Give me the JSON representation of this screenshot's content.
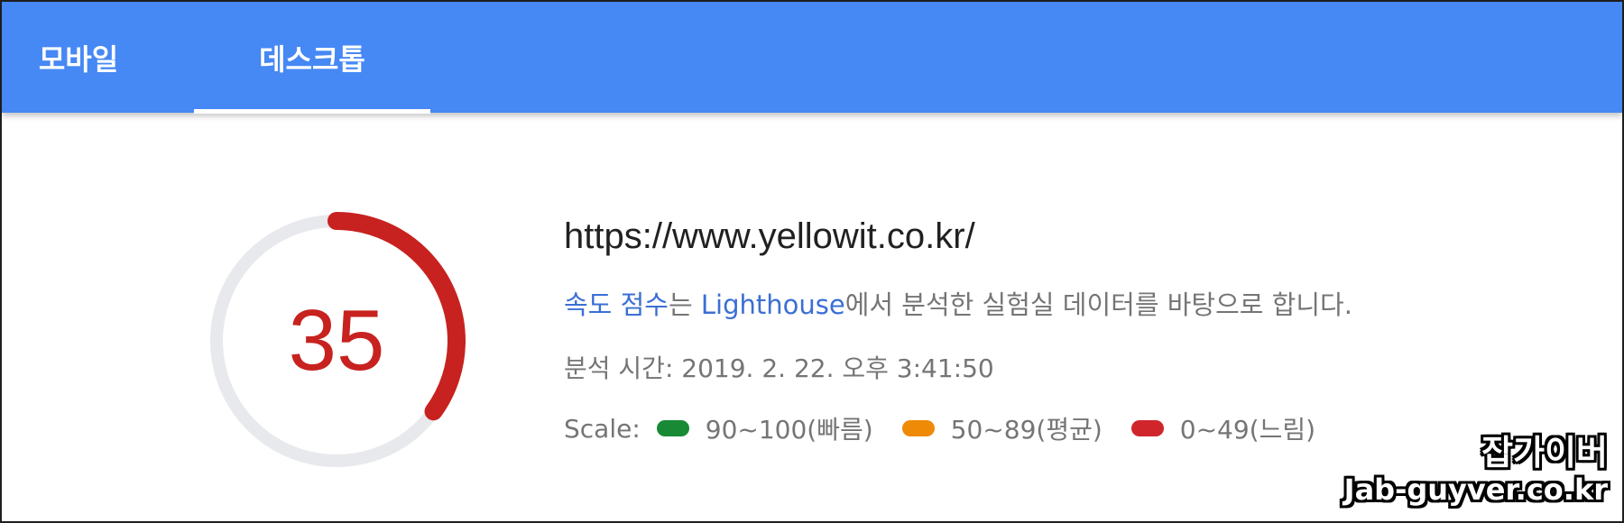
{
  "tabs": [
    {
      "label": "모바일",
      "active": false
    },
    {
      "label": "데스크톱",
      "active": true
    }
  ],
  "report": {
    "score": "35",
    "score_fraction": 0.35,
    "score_color": "#c7221f",
    "url": "https://www.yellowit.co.kr/",
    "desc_link1": "속도 점수",
    "desc_text1": "는 ",
    "desc_link2": "Lighthouse",
    "desc_text2": "에서 분석한 실험실 데이터를 바탕으로 합니다.",
    "analysis_time": "분석 시간: 2019. 2. 22. 오후 3:41:50"
  },
  "scale": {
    "label": "Scale:",
    "items": [
      {
        "range": "90~100(빠름)",
        "color": "#188a35"
      },
      {
        "range": "50~89(평균)",
        "color": "#ef8a06"
      },
      {
        "range": "0~49(느림)",
        "color": "#d0262b"
      }
    ]
  },
  "watermark": {
    "title": "잡가이버",
    "site": "Jab-guyver.co.kr"
  },
  "colors": {
    "tab_bar": "#4688f4",
    "link": "#3b6fd4",
    "gauge_track": "#e8e9ec"
  }
}
